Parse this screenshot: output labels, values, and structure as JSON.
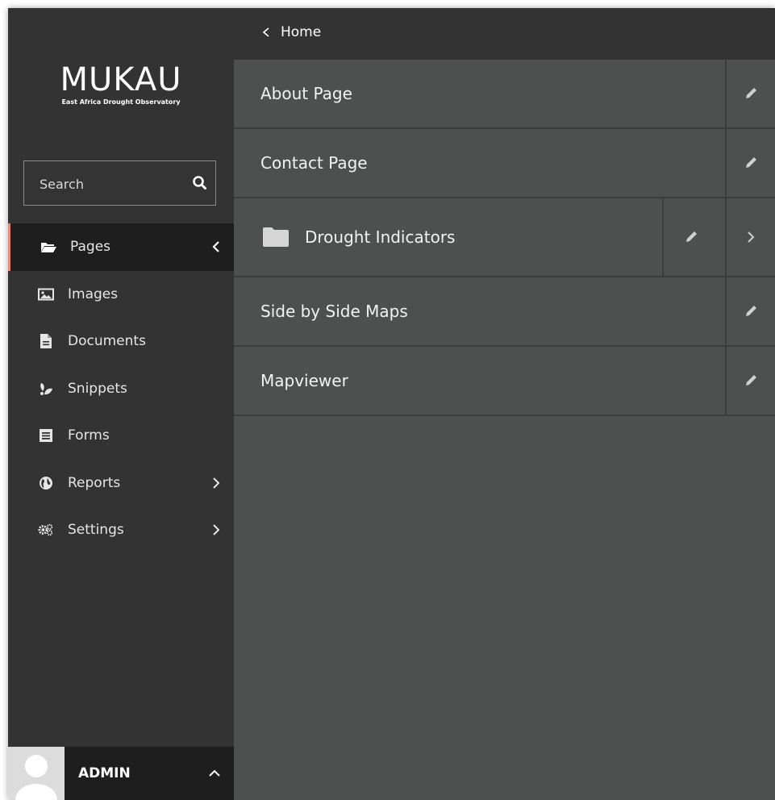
{
  "brand": {
    "name": "MUKAU",
    "tagline": "East Africa Drought Observatory"
  },
  "search": {
    "placeholder": "Search",
    "icon": "search-icon"
  },
  "nav": [
    {
      "label": "Pages",
      "icon": "folder-open-icon",
      "active": true,
      "chevron": "left"
    },
    {
      "label": "Images",
      "icon": "image-icon"
    },
    {
      "label": "Documents",
      "icon": "document-icon"
    },
    {
      "label": "Snippets",
      "icon": "snippets-icon"
    },
    {
      "label": "Forms",
      "icon": "form-icon"
    },
    {
      "label": "Reports",
      "icon": "globe-icon",
      "chevron": "right"
    },
    {
      "label": "Settings",
      "icon": "cogs-icon",
      "chevron": "right"
    }
  ],
  "account": {
    "name": "ADMIN"
  },
  "breadcrumb": {
    "label": "Home"
  },
  "pages": [
    {
      "title": "About Page"
    },
    {
      "title": "Contact Page"
    },
    {
      "title": "Drought Indicators",
      "has_children": true
    },
    {
      "title": "Side by Side Maps"
    },
    {
      "title": "Mapviewer"
    }
  ],
  "colors": {
    "sidebar": "#333333",
    "active_item": "#1e1e1e",
    "active_accent": "#e9877a",
    "content": "#4e4f4f"
  }
}
